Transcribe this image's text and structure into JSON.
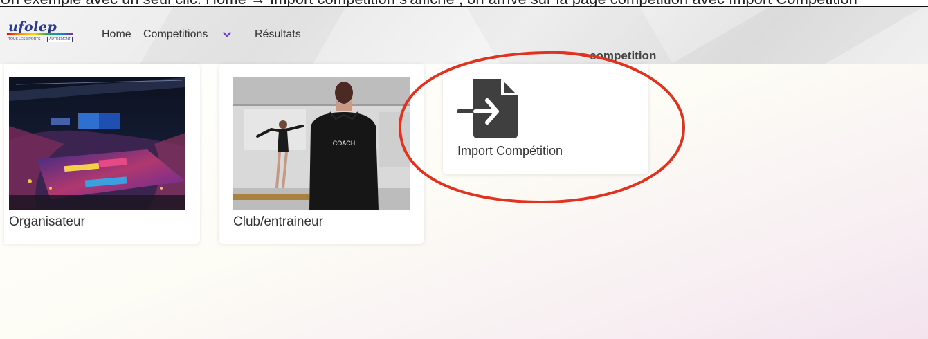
{
  "caption": "Un exemple avec un seul clic: Home → Import compétition s'affiche ; on arrive sur la page competition avec Import Compétition",
  "brand": {
    "name": "ufolep",
    "tagline": "TOUS LES SPORTS",
    "tagline_box": "AUTREMENT"
  },
  "nav": {
    "home": "Home",
    "competitions": "Competitions",
    "results": "Résultats",
    "page_title": "competition"
  },
  "cards": {
    "organizer": "Organisateur",
    "club": "Club/entraineur",
    "import": "Import Compétition"
  },
  "photo_text": {
    "coach": "COACH"
  },
  "icons": {
    "dropdown": "chevron-down-icon",
    "import": "file-import-icon"
  },
  "colors": {
    "accent": "#6b3fd4",
    "annotation": "#e0321e",
    "icon": "#3f3f3f"
  }
}
